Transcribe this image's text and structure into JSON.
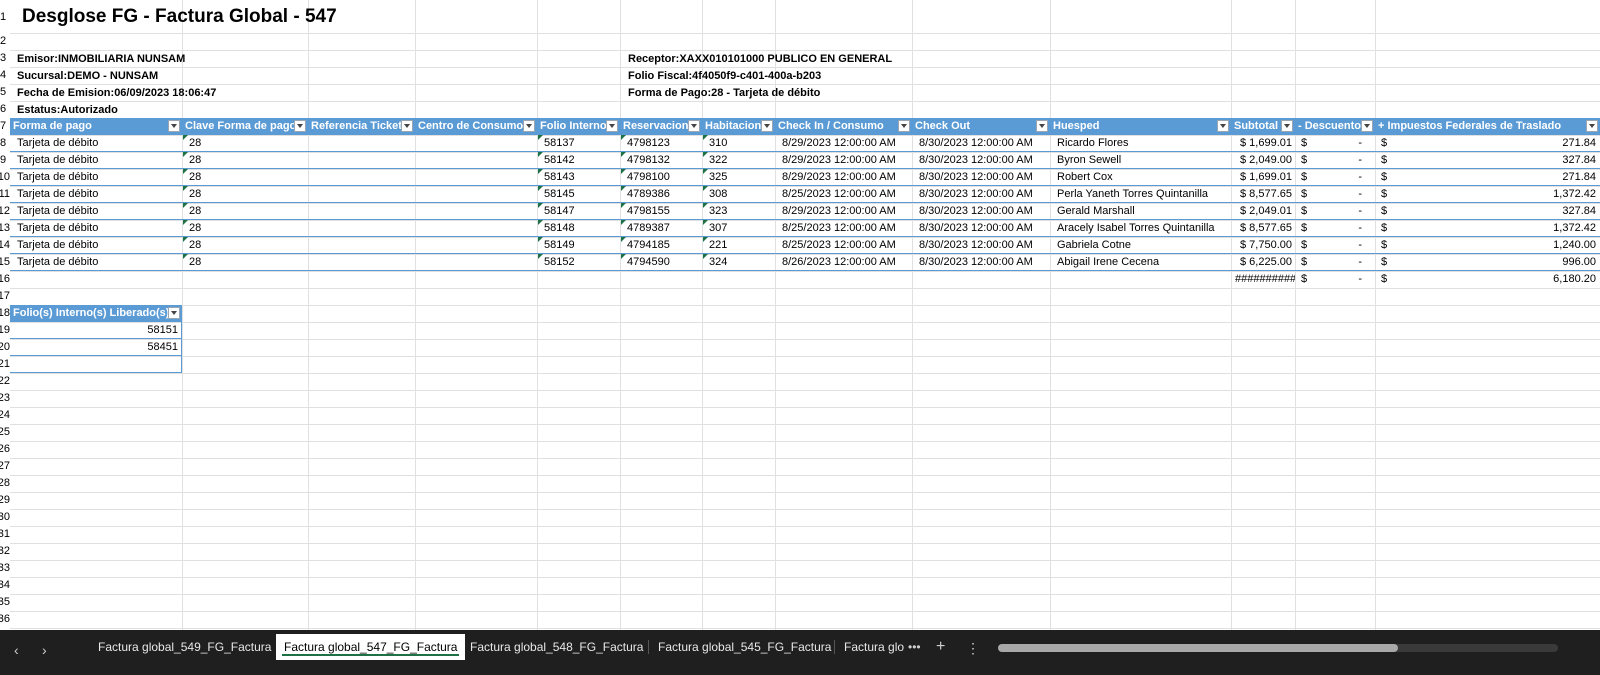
{
  "sheet": {
    "row_numbers": [
      "1",
      "2",
      "3",
      "4",
      "5",
      "6",
      "7",
      "8",
      "9",
      "10",
      "11",
      "12",
      "13",
      "14",
      "15",
      "16",
      "17",
      "18",
      "19",
      "20",
      "21",
      "22",
      "23",
      "24",
      "25",
      "26",
      "27",
      "28",
      "29",
      "30",
      "31",
      "32",
      "33",
      "34",
      "35",
      "36"
    ],
    "title": "Desglose FG - Factura Global - 547",
    "info": {
      "emisor": "Emisor:INMOBILIARIA NUNSAM",
      "sucursal": "Sucursal:DEMO - NUNSAM",
      "fecha": "Fecha de Emision:06/09/2023 18:06:47",
      "estatus": "Estatus:Autorizado",
      "receptor": "Receptor:XAXX010101000 PUBLICO EN GENERAL",
      "folio_fiscal": "Folio Fiscal:4f4050f9-c401-400a-b203",
      "forma_pago": "Forma de Pago:28 - Tarjeta de débito"
    },
    "table": {
      "headers": [
        "Forma de pago",
        "Clave Forma de pago",
        "Referencia Ticket",
        "Centro de Consumo",
        "Folio Interno",
        "Reservacion",
        "Habitacion",
        "Check In / Consumo",
        "Check Out",
        "Huesped",
        "Subtotal",
        "- Descuento",
        "+ Impuestos Federales de Traslado"
      ],
      "rows": [
        [
          "Tarjeta de débito",
          "28",
          "",
          "",
          "58137",
          "4798123",
          "310",
          "8/29/2023 12:00:00 AM",
          "8/30/2023 12:00:00 AM",
          "Ricardo Flores",
          "$ 1,699.01",
          "$",
          "-",
          "$",
          "271.84"
        ],
        [
          "Tarjeta de débito",
          "28",
          "",
          "",
          "58142",
          "4798132",
          "322",
          "8/29/2023 12:00:00 AM",
          "8/30/2023 12:00:00 AM",
          "Byron Sewell",
          "$ 2,049.00",
          "$",
          "-",
          "$",
          "327.84"
        ],
        [
          "Tarjeta de débito",
          "28",
          "",
          "",
          "58143",
          "4798100",
          "325",
          "8/29/2023 12:00:00 AM",
          "8/30/2023 12:00:00 AM",
          "Robert Cox",
          "$ 1,699.01",
          "$",
          "-",
          "$",
          "271.84"
        ],
        [
          "Tarjeta de débito",
          "28",
          "",
          "",
          "58145",
          "4789386",
          "308",
          "8/25/2023 12:00:00 AM",
          "8/30/2023 12:00:00 AM",
          "Perla Yaneth Torres Quintanilla",
          "$ 8,577.65",
          "$",
          "-",
          "$",
          "1,372.42"
        ],
        [
          "Tarjeta de débito",
          "28",
          "",
          "",
          "58147",
          "4798155",
          "323",
          "8/29/2023 12:00:00 AM",
          "8/30/2023 12:00:00 AM",
          "Gerald Marshall",
          "$ 2,049.01",
          "$",
          "-",
          "$",
          "327.84"
        ],
        [
          "Tarjeta de débito",
          "28",
          "",
          "",
          "58148",
          "4789387",
          "307",
          "8/25/2023 12:00:00 AM",
          "8/30/2023 12:00:00 AM",
          "Aracely Isabel Torres Quintanilla",
          "$ 8,577.65",
          "$",
          "-",
          "$",
          "1,372.42"
        ],
        [
          "Tarjeta de débito",
          "28",
          "",
          "",
          "58149",
          "4794185",
          "221",
          "8/25/2023 12:00:00 AM",
          "8/30/2023 12:00:00 AM",
          "Gabriela Cotne",
          "$ 7,750.00",
          "$",
          "-",
          "$",
          "1,240.00"
        ],
        [
          "Tarjeta de débito",
          "28",
          "",
          "",
          "58152",
          "4794590",
          "324",
          "8/26/2023 12:00:00 AM",
          "8/30/2023 12:00:00 AM",
          "Abigail Irene Cecena",
          "$ 6,225.00",
          "$",
          "-",
          "$",
          "996.00"
        ]
      ],
      "totals": {
        "subtotal": "##########",
        "descuento_sign": "$",
        "descuento": "-",
        "impuestos_sign": "$",
        "impuestos": "6,180.20"
      }
    },
    "liberados": {
      "header": "Folio(s) Interno(s) Liberado(s)",
      "values": [
        "58151",
        "58451"
      ]
    }
  },
  "tabs": {
    "items": [
      "Factura global_549_FG_Factura",
      "Factura global_547_FG_Factura",
      "Factura global_548_FG_Factura",
      "Factura global_545_FG_Factura",
      "Factura glo"
    ],
    "active_index": 1,
    "more": "•••",
    "add": "+",
    "menu": "⋮",
    "prev": "‹",
    "next": "›"
  },
  "colors": {
    "header_bg": "#5b9bd5",
    "accent": "#1e7145",
    "tabbar_bg": "#1f1f1f"
  }
}
